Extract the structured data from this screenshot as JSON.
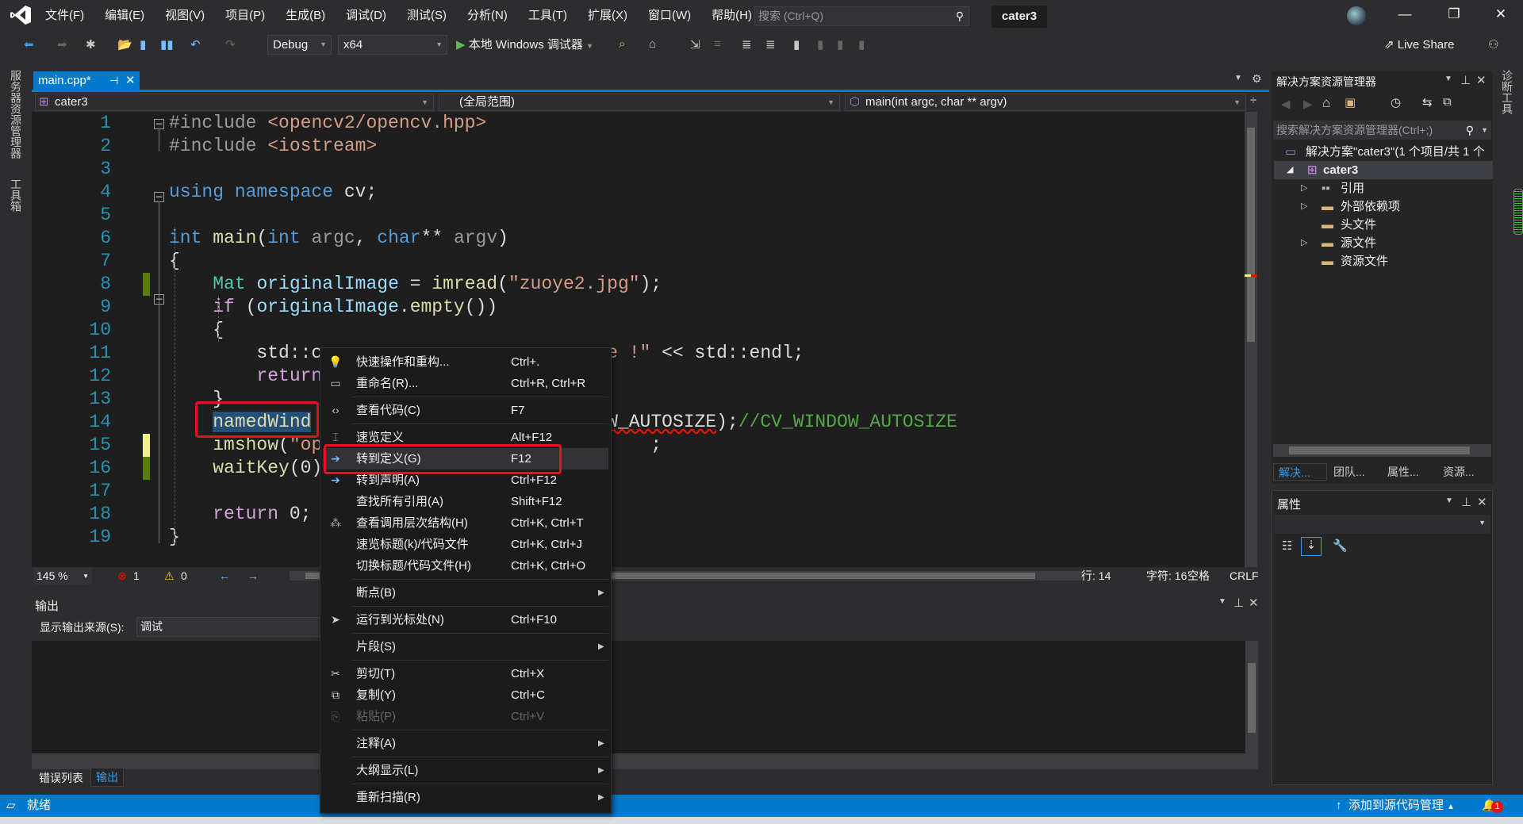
{
  "titlebar": {
    "menus": [
      "文件(F)",
      "编辑(E)",
      "视图(V)",
      "项目(P)",
      "生成(B)",
      "调试(D)",
      "测试(S)",
      "分析(N)",
      "工具(T)",
      "扩展(X)",
      "窗口(W)",
      "帮助(H)"
    ],
    "search_placeholder": "搜索 (Ctrl+Q)",
    "project_name": "cater3",
    "minimize": "—",
    "maximize": "❐",
    "close": "✕"
  },
  "toolbar": {
    "config": "Debug",
    "platform": "x64",
    "debugger": "本地 Windows 调试器",
    "live_share": "Live Share"
  },
  "left_strip": {
    "server_explorer": "服务器资源管理器",
    "toolbox": "工具箱"
  },
  "right_strip": {
    "diagnostics": "诊断工具"
  },
  "editor": {
    "tab_label": "main.cpp*",
    "nav_project": "cater3",
    "nav_scope": "(全局范围)",
    "nav_member": "main(int argc, char ** argv)",
    "lines": [
      {
        "n": "1",
        "segs": [
          {
            "t": "#include ",
            "c": "pp"
          },
          {
            "t": "<opencv2/opencv.hpp>",
            "c": "st"
          }
        ]
      },
      {
        "n": "2",
        "segs": [
          {
            "t": "#include ",
            "c": "pp"
          },
          {
            "t": "<iostream>",
            "c": "st"
          }
        ]
      },
      {
        "n": "3",
        "segs": []
      },
      {
        "n": "4",
        "segs": [
          {
            "t": "using namespace ",
            "c": "kw"
          },
          {
            "t": "cv;",
            "c": "pl"
          }
        ]
      },
      {
        "n": "5",
        "segs": []
      },
      {
        "n": "6",
        "segs": [
          {
            "t": "int ",
            "c": "kw"
          },
          {
            "t": "main",
            "c": "fn"
          },
          {
            "t": "(",
            "c": "pl"
          },
          {
            "t": "int ",
            "c": "kw"
          },
          {
            "t": "argc",
            "c": "pa"
          },
          {
            "t": ", ",
            "c": "pl"
          },
          {
            "t": "char",
            "c": "kw"
          },
          {
            "t": "** ",
            "c": "pl"
          },
          {
            "t": "argv",
            "c": "pa"
          },
          {
            "t": ")",
            "c": "pl"
          }
        ]
      },
      {
        "n": "7",
        "segs": [
          {
            "t": "{",
            "c": "pl"
          }
        ]
      },
      {
        "n": "8",
        "segs": [
          {
            "t": "    ",
            "c": "pl"
          },
          {
            "t": "Mat ",
            "c": "ty"
          },
          {
            "t": "originalImage",
            "c": "id"
          },
          {
            "t": " = ",
            "c": "pl"
          },
          {
            "t": "imread",
            "c": "fn"
          },
          {
            "t": "(",
            "c": "pl"
          },
          {
            "t": "\"zuoye2.jpg\"",
            "c": "st"
          },
          {
            "t": ");",
            "c": "pl"
          }
        ]
      },
      {
        "n": "9",
        "segs": [
          {
            "t": "    ",
            "c": "pl"
          },
          {
            "t": "if ",
            "c": "ctl"
          },
          {
            "t": "(",
            "c": "pl"
          },
          {
            "t": "originalImage",
            "c": "id"
          },
          {
            "t": ".",
            "c": "pl"
          },
          {
            "t": "empty",
            "c": "fn"
          },
          {
            "t": "())",
            "c": "pl"
          }
        ]
      },
      {
        "n": "10",
        "segs": [
          {
            "t": "    {",
            "c": "pl"
          }
        ]
      },
      {
        "n": "11",
        "segs": [
          {
            "t": "        std::c",
            "c": "pl"
          },
          {
            "t": "                          ",
            "c": "pl"
          },
          {
            "t": "e !\"",
            "c": "st"
          },
          {
            "t": " << std::endl;",
            "c": "pl"
          }
        ]
      },
      {
        "n": "12",
        "segs": [
          {
            "t": "        ",
            "c": "pl"
          },
          {
            "t": "return",
            "c": "ctl"
          }
        ]
      },
      {
        "n": "13",
        "segs": [
          {
            "t": "    }",
            "c": "pl"
          }
        ]
      },
      {
        "n": "14",
        "segs": [
          {
            "t": "    ",
            "c": "pl"
          },
          {
            "t": "namedWind",
            "c": "fn sel"
          },
          {
            "t": "                           ",
            "c": "pl"
          },
          {
            "t": "W_AUTOSIZE",
            "c": "pl squig"
          },
          {
            "t": ");",
            "c": "pl"
          },
          {
            "t": "//CV_WINDOW_AUTOSIZE",
            "c": "cm"
          }
        ]
      },
      {
        "n": "15",
        "segs": [
          {
            "t": "    ",
            "c": "pl"
          },
          {
            "t": "imshow",
            "c": "fn"
          },
          {
            "t": "(",
            "c": "pl"
          },
          {
            "t": "\"op",
            "c": "st"
          },
          {
            "t": "                              ;",
            "c": "pl"
          }
        ]
      },
      {
        "n": "16",
        "segs": [
          {
            "t": "    ",
            "c": "pl"
          },
          {
            "t": "waitKey",
            "c": "fn"
          },
          {
            "t": "(0)",
            "c": "pl"
          }
        ]
      },
      {
        "n": "17",
        "segs": []
      },
      {
        "n": "18",
        "segs": [
          {
            "t": "    ",
            "c": "pl"
          },
          {
            "t": "return ",
            "c": "ctl"
          },
          {
            "t": "0;",
            "c": "pl"
          }
        ]
      },
      {
        "n": "19",
        "segs": [
          {
            "t": "}",
            "c": "pl"
          }
        ]
      }
    ],
    "zoom": "145 %",
    "errors": "1",
    "warnings": "0",
    "row": "行: 14",
    "col": "字符: 16",
    "spacing": "空格",
    "line_ending": "CRLF"
  },
  "context_menu": [
    {
      "label": "快速操作和重构...",
      "shortcut": "Ctrl+.",
      "icon": "lightbulb-icon"
    },
    {
      "label": "重命名(R)...",
      "shortcut": "Ctrl+R, Ctrl+R",
      "icon": "rename-icon",
      "sep_after": true
    },
    {
      "label": "查看代码(C)",
      "shortcut": "F7",
      "icon": "code-icon",
      "sep_after": true
    },
    {
      "label": "速览定义",
      "shortcut": "Alt+F12",
      "icon": "peek-definition-icon"
    },
    {
      "label": "转到定义(G)",
      "shortcut": "F12",
      "icon": "go-to-definition-icon",
      "highlighted": true
    },
    {
      "label": "转到声明(A)",
      "shortcut": "Ctrl+F12",
      "icon": "go-to-declaration-icon"
    },
    {
      "label": "查找所有引用(A)",
      "shortcut": "Shift+F12",
      "icon": ""
    },
    {
      "label": "查看调用层次结构(H)",
      "shortcut": "Ctrl+K, Ctrl+T",
      "icon": "call-hierarchy-icon"
    },
    {
      "label": "速览标题(k)/代码文件",
      "shortcut": "Ctrl+K, Ctrl+J",
      "icon": ""
    },
    {
      "label": "切换标题/代码文件(H)",
      "shortcut": "Ctrl+K, Ctrl+O",
      "icon": "",
      "sep_after": true
    },
    {
      "label": "断点(B)",
      "shortcut": "",
      "icon": "",
      "submenu": true,
      "sep_after": true
    },
    {
      "label": "运行到光标处(N)",
      "shortcut": "Ctrl+F10",
      "icon": "cursor-icon",
      "sep_after": true
    },
    {
      "label": "片段(S)",
      "shortcut": "",
      "icon": "",
      "submenu": true,
      "sep_after": true
    },
    {
      "label": "剪切(T)",
      "shortcut": "Ctrl+X",
      "icon": "scissors-icon"
    },
    {
      "label": "复制(Y)",
      "shortcut": "Ctrl+C",
      "icon": "copy-icon"
    },
    {
      "label": "粘贴(P)",
      "shortcut": "Ctrl+V",
      "icon": "paste-icon",
      "disabled": true,
      "sep_after": true
    },
    {
      "label": "注释(A)",
      "shortcut": "",
      "icon": "",
      "submenu": true,
      "sep_after": true
    },
    {
      "label": "大纲显示(L)",
      "shortcut": "",
      "icon": "",
      "submenu": true,
      "sep_after": true
    },
    {
      "label": "重新扫描(R)",
      "shortcut": "",
      "icon": "",
      "submenu": true
    }
  ],
  "output": {
    "title": "输出",
    "source_label": "显示输出来源(S):",
    "source_value": "调试",
    "tabs": [
      "错误列表",
      "输出"
    ]
  },
  "solution_explorer": {
    "title": "解决方案资源管理器",
    "search_placeholder": "搜索解决方案资源管理器(Ctrl+;)",
    "solution": "解决方案\"cater3\"(1 个项目/共 1 个",
    "project": "cater3",
    "items": [
      "引用",
      "外部依赖项",
      "头文件",
      "源文件",
      "资源文件"
    ],
    "tabs": [
      "解决...",
      "团队...",
      "属性...",
      "资源..."
    ]
  },
  "properties": {
    "title": "属性"
  },
  "statusbar": {
    "ready": "就绪",
    "source_control": "添加到源代码管理",
    "notifications": "1"
  },
  "colors": {
    "accent": "#007acc",
    "highlight_box": "#e81123",
    "editor_bg": "#1e1e1e"
  }
}
